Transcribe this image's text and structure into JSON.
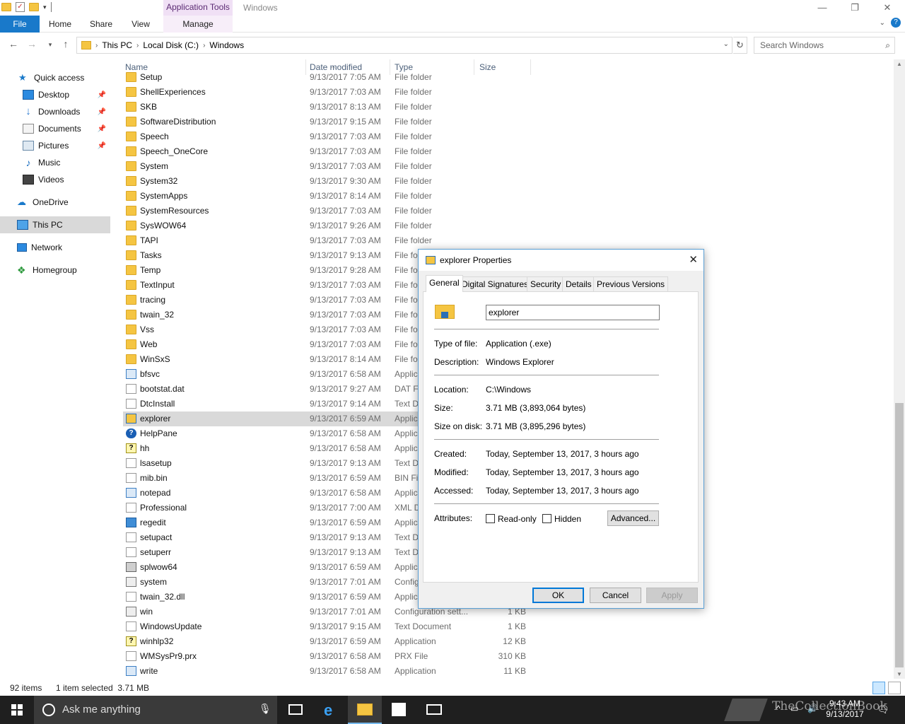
{
  "window": {
    "title": "Windows",
    "contextual_tab_group": "Application Tools",
    "controls": {
      "minimize": "—",
      "restore": "❐",
      "close": "✕"
    }
  },
  "ribbon": {
    "tabs": [
      "File",
      "Home",
      "Share",
      "View",
      "Manage"
    ],
    "expand": "⌄",
    "help": "?"
  },
  "address": {
    "breadcrumbs": [
      "This PC",
      "Local Disk (C:)",
      "Windows"
    ],
    "search_placeholder": "Search Windows",
    "icons": [
      "back-arrow-icon",
      "forward-arrow-icon",
      "recent-dropdown-icon",
      "up-arrow-icon",
      "refresh-icon",
      "search-icon"
    ]
  },
  "nav": {
    "items": [
      {
        "label": "Quick access",
        "icon": "star-icon",
        "pinned": false
      },
      {
        "label": "Desktop",
        "icon": "desktop-icon",
        "pinned": true
      },
      {
        "label": "Downloads",
        "icon": "download-icon",
        "pinned": true
      },
      {
        "label": "Documents",
        "icon": "documents-icon",
        "pinned": true
      },
      {
        "label": "Pictures",
        "icon": "pictures-icon",
        "pinned": true
      },
      {
        "label": "Music",
        "icon": "music-icon",
        "pinned": false
      },
      {
        "label": "Videos",
        "icon": "videos-icon",
        "pinned": false
      },
      {
        "label": "OneDrive",
        "icon": "cloud-icon",
        "pinned": false
      },
      {
        "label": "This PC",
        "icon": "computer-icon",
        "pinned": false,
        "selected": true
      },
      {
        "label": "Network",
        "icon": "network-icon",
        "pinned": false
      },
      {
        "label": "Homegroup",
        "icon": "homegroup-icon",
        "pinned": false
      }
    ]
  },
  "list": {
    "columns": [
      "Name",
      "Date modified",
      "Type",
      "Size"
    ],
    "rows": [
      {
        "name": "Setup",
        "date": "9/13/2017 7:05 AM",
        "type": "File folder",
        "size": "",
        "icon": "folder"
      },
      {
        "name": "ShellExperiences",
        "date": "9/13/2017 7:03 AM",
        "type": "File folder",
        "size": "",
        "icon": "folder"
      },
      {
        "name": "SKB",
        "date": "9/13/2017 8:13 AM",
        "type": "File folder",
        "size": "",
        "icon": "folder"
      },
      {
        "name": "SoftwareDistribution",
        "date": "9/13/2017 9:15 AM",
        "type": "File folder",
        "size": "",
        "icon": "folder"
      },
      {
        "name": "Speech",
        "date": "9/13/2017 7:03 AM",
        "type": "File folder",
        "size": "",
        "icon": "folder"
      },
      {
        "name": "Speech_OneCore",
        "date": "9/13/2017 7:03 AM",
        "type": "File folder",
        "size": "",
        "icon": "folder"
      },
      {
        "name": "System",
        "date": "9/13/2017 7:03 AM",
        "type": "File folder",
        "size": "",
        "icon": "folder"
      },
      {
        "name": "System32",
        "date": "9/13/2017 9:30 AM",
        "type": "File folder",
        "size": "",
        "icon": "folder"
      },
      {
        "name": "SystemApps",
        "date": "9/13/2017 8:14 AM",
        "type": "File folder",
        "size": "",
        "icon": "folder"
      },
      {
        "name": "SystemResources",
        "date": "9/13/2017 7:03 AM",
        "type": "File folder",
        "size": "",
        "icon": "folder"
      },
      {
        "name": "SysWOW64",
        "date": "9/13/2017 9:26 AM",
        "type": "File folder",
        "size": "",
        "icon": "folder"
      },
      {
        "name": "TAPI",
        "date": "9/13/2017 7:03 AM",
        "type": "File folder",
        "size": "",
        "icon": "folder"
      },
      {
        "name": "Tasks",
        "date": "9/13/2017 9:13 AM",
        "type": "File fo",
        "size": "",
        "icon": "folder"
      },
      {
        "name": "Temp",
        "date": "9/13/2017 9:28 AM",
        "type": "File fo",
        "size": "",
        "icon": "folder"
      },
      {
        "name": "TextInput",
        "date": "9/13/2017 7:03 AM",
        "type": "File fo",
        "size": "",
        "icon": "folder"
      },
      {
        "name": "tracing",
        "date": "9/13/2017 7:03 AM",
        "type": "File fo",
        "size": "",
        "icon": "folder"
      },
      {
        "name": "twain_32",
        "date": "9/13/2017 7:03 AM",
        "type": "File fo",
        "size": "",
        "icon": "folder"
      },
      {
        "name": "Vss",
        "date": "9/13/2017 7:03 AM",
        "type": "File fo",
        "size": "",
        "icon": "folder"
      },
      {
        "name": "Web",
        "date": "9/13/2017 7:03 AM",
        "type": "File fo",
        "size": "",
        "icon": "folder"
      },
      {
        "name": "WinSxS",
        "date": "9/13/2017 8:14 AM",
        "type": "File fo",
        "size": "",
        "icon": "folder"
      },
      {
        "name": "bfsvc",
        "date": "9/13/2017 6:58 AM",
        "type": "Applic",
        "size": "",
        "icon": "app"
      },
      {
        "name": "bootstat.dat",
        "date": "9/13/2017 9:27 AM",
        "type": "DAT Fi",
        "size": "",
        "icon": "file"
      },
      {
        "name": "DtcInstall",
        "date": "9/13/2017 9:14 AM",
        "type": "Text D",
        "size": "",
        "icon": "file"
      },
      {
        "name": "explorer",
        "date": "9/13/2017 6:59 AM",
        "type": "Applic",
        "size": "",
        "icon": "explorer",
        "selected": true
      },
      {
        "name": "HelpPane",
        "date": "9/13/2017 6:58 AM",
        "type": "Applic",
        "size": "",
        "icon": "help"
      },
      {
        "name": "hh",
        "date": "9/13/2017 6:58 AM",
        "type": "Applic",
        "size": "",
        "icon": "hh"
      },
      {
        "name": "lsasetup",
        "date": "9/13/2017 9:13 AM",
        "type": "Text D",
        "size": "",
        "icon": "file"
      },
      {
        "name": "mib.bin",
        "date": "9/13/2017 6:59 AM",
        "type": "BIN Fil",
        "size": "",
        "icon": "file"
      },
      {
        "name": "notepad",
        "date": "9/13/2017 6:58 AM",
        "type": "Applic",
        "size": "",
        "icon": "app"
      },
      {
        "name": "Professional",
        "date": "9/13/2017 7:00 AM",
        "type": "XML D",
        "size": "",
        "icon": "file"
      },
      {
        "name": "regedit",
        "date": "9/13/2017 6:59 AM",
        "type": "Applic",
        "size": "",
        "icon": "reg"
      },
      {
        "name": "setupact",
        "date": "9/13/2017 9:13 AM",
        "type": "Text D",
        "size": "",
        "icon": "file"
      },
      {
        "name": "setuperr",
        "date": "9/13/2017 9:13 AM",
        "type": "Text D",
        "size": "",
        "icon": "file"
      },
      {
        "name": "splwow64",
        "date": "9/13/2017 6:59 AM",
        "type": "Applic",
        "size": "",
        "icon": "print"
      },
      {
        "name": "system",
        "date": "9/13/2017 7:01 AM",
        "type": "Config",
        "size": "",
        "icon": "cfg"
      },
      {
        "name": "twain_32.dll",
        "date": "9/13/2017 6:59 AM",
        "type": "Applic",
        "size": "",
        "icon": "file"
      },
      {
        "name": "win",
        "date": "9/13/2017 7:01 AM",
        "type": "Configuration sett...",
        "size": "1 KB",
        "icon": "cfg"
      },
      {
        "name": "WindowsUpdate",
        "date": "9/13/2017 9:15 AM",
        "type": "Text Document",
        "size": "1 KB",
        "icon": "file"
      },
      {
        "name": "winhlp32",
        "date": "9/13/2017 6:59 AM",
        "type": "Application",
        "size": "12 KB",
        "icon": "hh"
      },
      {
        "name": "WMSysPr9.prx",
        "date": "9/13/2017 6:58 AM",
        "type": "PRX File",
        "size": "310 KB",
        "icon": "file"
      },
      {
        "name": "write",
        "date": "9/13/2017 6:58 AM",
        "type": "Application",
        "size": "11 KB",
        "icon": "app"
      }
    ]
  },
  "status": {
    "count": "92 items",
    "selection": "1 item selected  3.71 MB"
  },
  "dialog": {
    "title": "explorer Properties",
    "close": "✕",
    "tabs": [
      "General",
      "Digital Signatures",
      "Security",
      "Details",
      "Previous Versions"
    ],
    "filename": "explorer",
    "fields": [
      {
        "label": "Type of file:",
        "value": "Application (.exe)"
      },
      {
        "label": "Description:",
        "value": "Windows Explorer"
      },
      {
        "label": "Location:",
        "value": "C:\\Windows"
      },
      {
        "label": "Size:",
        "value": "3.71 MB (3,893,064 bytes)"
      },
      {
        "label": "Size on disk:",
        "value": "3.71 MB (3,895,296 bytes)"
      },
      {
        "label": "Created:",
        "value": "Today, September 13, 2017, 3 hours ago"
      },
      {
        "label": "Modified:",
        "value": "Today, September 13, 2017, 3 hours ago"
      },
      {
        "label": "Accessed:",
        "value": "Today, September 13, 2017, 3 hours ago"
      }
    ],
    "attributes_label": "Attributes:",
    "readonly_label": "Read-only",
    "hidden_label": "Hidden",
    "advanced_label": "Advanced...",
    "ok": "OK",
    "cancel": "Cancel",
    "apply": "Apply"
  },
  "taskbar": {
    "search_text": "Ask me anything",
    "time": "9:43 AM",
    "date": "9/13/2017",
    "watermark": "TheCollectionBook",
    "tray_icons": [
      "chevron-up-icon",
      "network-icon",
      "volume-icon",
      "action-center-icon"
    ]
  }
}
